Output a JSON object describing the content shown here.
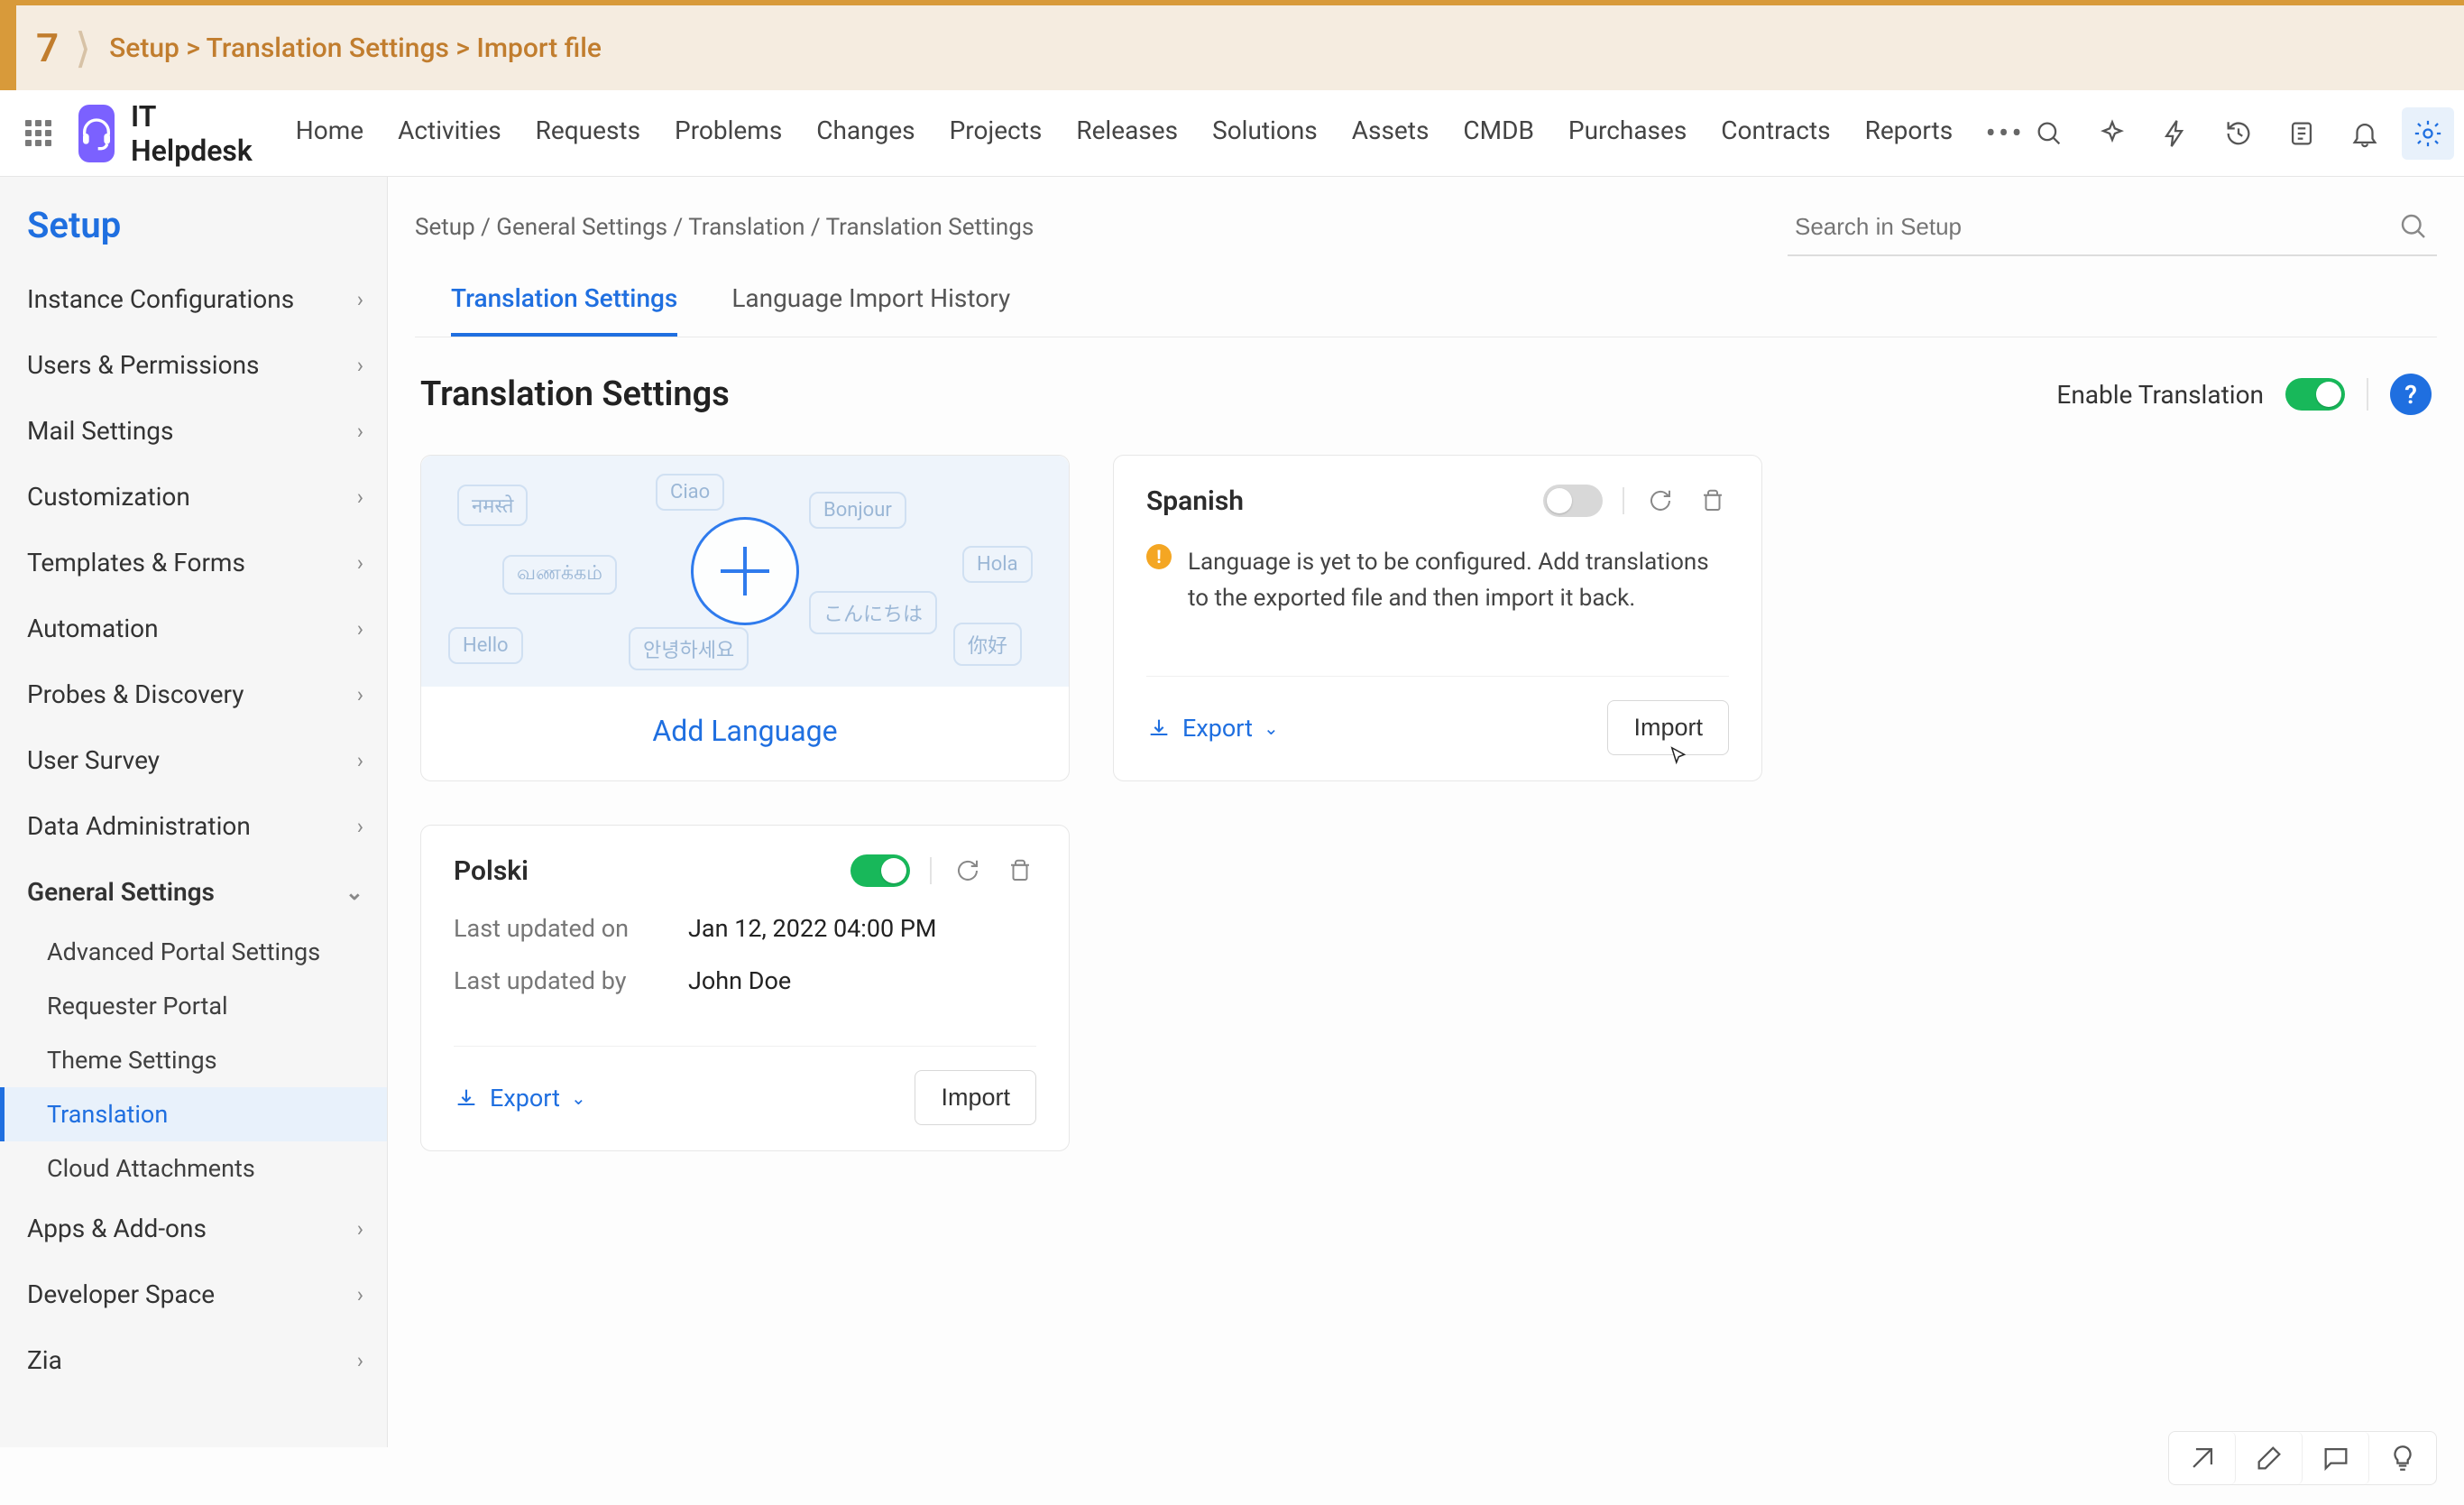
{
  "tutorial": {
    "step_number": "7",
    "crumb": "Setup > Translation Settings > Import file"
  },
  "brand": {
    "name": "IT Helpdesk"
  },
  "top_menu": {
    "items": [
      "Home",
      "Activities",
      "Requests",
      "Problems",
      "Changes",
      "Projects",
      "Releases",
      "Solutions",
      "Assets",
      "CMDB",
      "Purchases",
      "Contracts",
      "Reports"
    ],
    "more": "•••"
  },
  "breadcrumbs": "Setup / General Settings / Translation / Translation Settings",
  "setup_search_placeholder": "Search in Setup",
  "sidebar": {
    "title": "Setup",
    "sections": [
      {
        "label": "Instance Configurations",
        "has_sub": true
      },
      {
        "label": "Users & Permissions",
        "has_sub": true
      },
      {
        "label": "Mail Settings",
        "has_sub": true
      },
      {
        "label": "Customization",
        "has_sub": true
      },
      {
        "label": "Templates & Forms",
        "has_sub": true
      },
      {
        "label": "Automation",
        "has_sub": true
      },
      {
        "label": "Probes & Discovery",
        "has_sub": true
      },
      {
        "label": "User Survey",
        "has_sub": true
      },
      {
        "label": "Data Administration",
        "has_sub": true
      },
      {
        "label": "General Settings",
        "has_sub": true,
        "expanded": true,
        "children": [
          {
            "label": "Advanced Portal Settings"
          },
          {
            "label": "Requester Portal"
          },
          {
            "label": "Theme Settings"
          },
          {
            "label": "Translation",
            "active": true
          },
          {
            "label": "Cloud Attachments"
          }
        ]
      },
      {
        "label": "Apps & Add-ons",
        "has_sub": true
      },
      {
        "label": "Developer Space",
        "has_sub": true
      },
      {
        "label": "Zia",
        "has_sub": true
      }
    ]
  },
  "tabs": {
    "items": [
      {
        "label": "Translation Settings",
        "active": true
      },
      {
        "label": "Language Import History"
      }
    ]
  },
  "page": {
    "title": "Translation Settings",
    "enable_label": "Enable Translation"
  },
  "add_card": {
    "label": "Add Language",
    "cloud_words": [
      "नमस्ते",
      "Ciao",
      "Bonjour",
      "Hola",
      "வணக்கம்",
      "こんにちは",
      "Hello",
      "안녕하세요",
      "你好"
    ]
  },
  "spanish_card": {
    "title": "Spanish",
    "enabled": false,
    "warning": "Language is yet to be configured. Add translations to the exported file and then import it back.",
    "export_label": "Export",
    "import_label": "Import"
  },
  "polski_card": {
    "title": "Polski",
    "enabled": true,
    "last_updated_on_label": "Last updated on",
    "last_updated_on_value": "Jan 12, 2022 04:00 PM",
    "last_updated_by_label": "Last updated by",
    "last_updated_by_value": "John Doe",
    "export_label": "Export",
    "import_label": "Import"
  }
}
